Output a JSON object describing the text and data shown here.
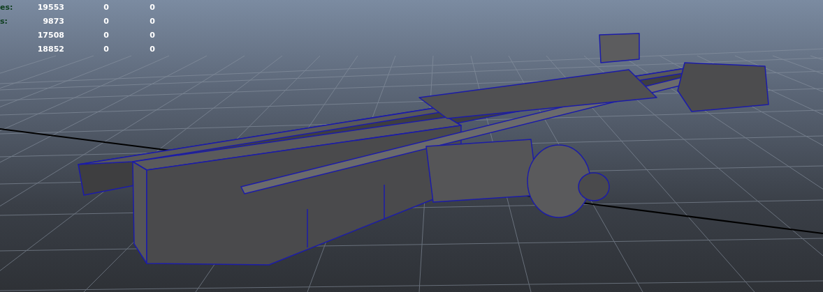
{
  "hud": {
    "rows": [
      {
        "label": "es:",
        "values": [
          "19553",
          "0",
          "0"
        ]
      },
      {
        "label": "s:",
        "values": [
          "9873",
          "0",
          "0"
        ]
      },
      {
        "values": [
          "17508",
          "0",
          "0"
        ]
      },
      {
        "values": [
          "18852",
          "0",
          "0"
        ]
      }
    ]
  }
}
